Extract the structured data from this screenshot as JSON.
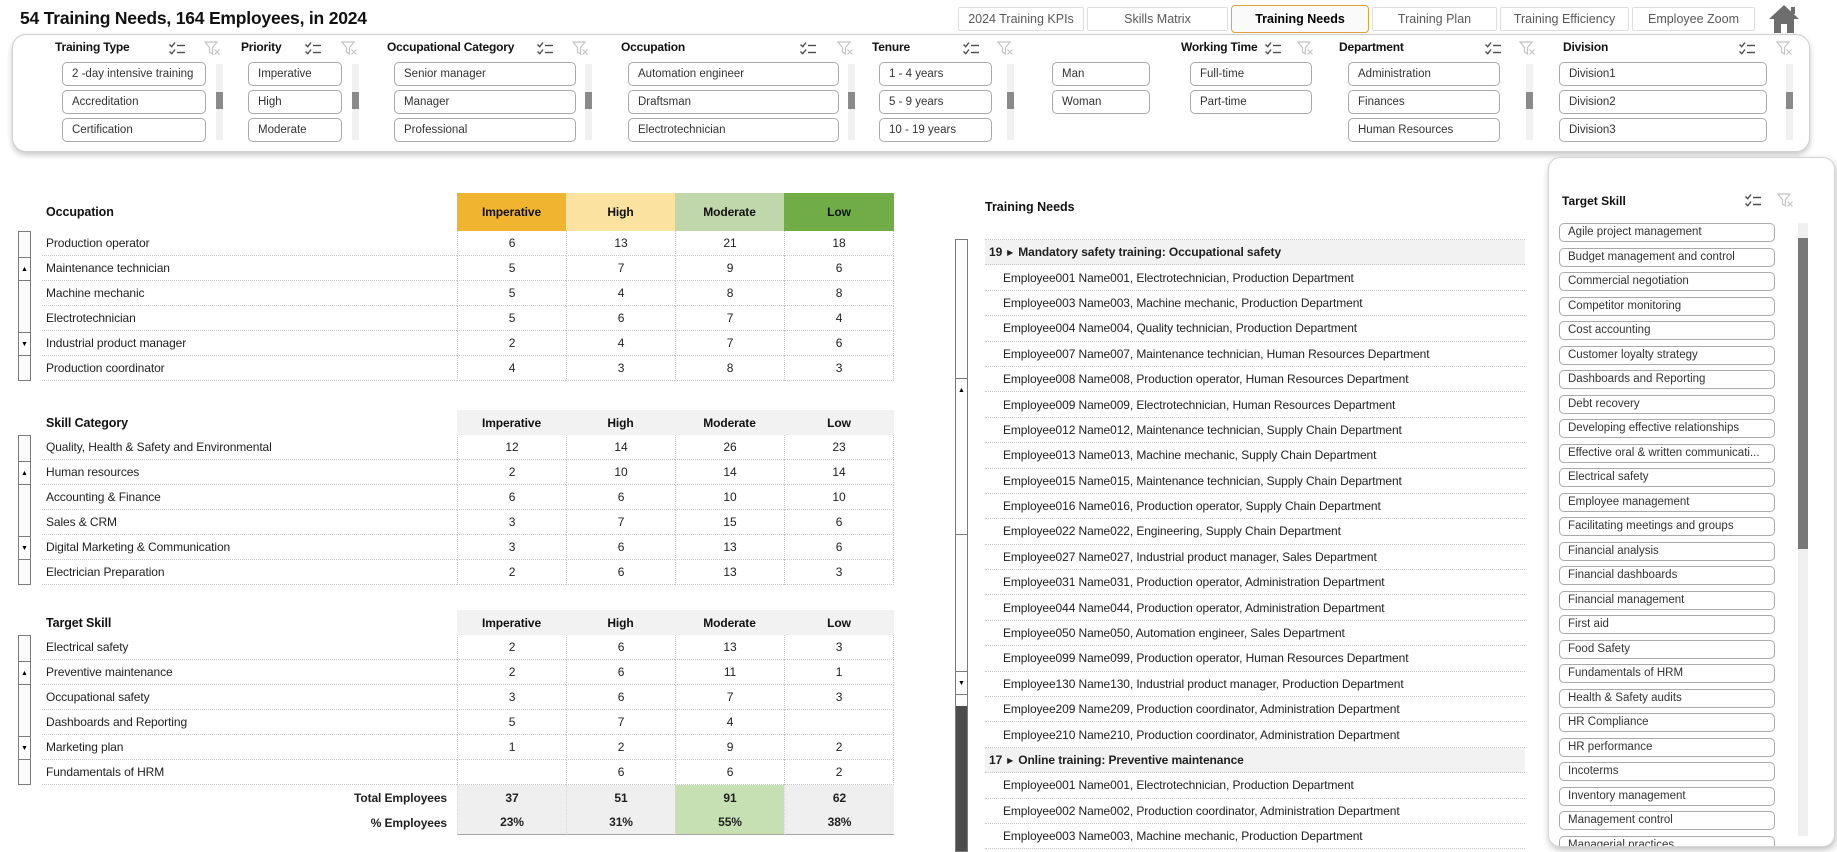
{
  "title": "54 Training Needs, 164 Employees, in 2024",
  "tabs": [
    {
      "label": "2024 Training KPIs",
      "active": false
    },
    {
      "label": "Skills Matrix",
      "active": false
    },
    {
      "label": "Training Needs",
      "active": true
    },
    {
      "label": "Training Plan",
      "active": false
    },
    {
      "label": "Training Efficiency",
      "active": false
    },
    {
      "label": "Employee Zoom",
      "active": false
    }
  ],
  "filters": [
    {
      "title": "Training Type",
      "items": [
        "2 -day intensive training",
        "Accreditation",
        "Certification"
      ],
      "scrollbar": true
    },
    {
      "title": "Priority",
      "items": [
        "Imperative",
        "High",
        "Moderate"
      ],
      "scrollbar": true
    },
    {
      "title": "Occupational Category",
      "items": [
        "Senior manager",
        "Manager",
        "Professional"
      ],
      "scrollbar": true
    },
    {
      "title": "Occupation",
      "items": [
        "Automation engineer",
        "Draftsman",
        "Electrotechnician"
      ],
      "scrollbar": true
    },
    {
      "title": "Tenure",
      "items": [
        "1 - 4 years",
        "5 - 9 years",
        "10 - 19 years"
      ],
      "scrollbar": true
    },
    {
      "title": "",
      "items": [
        "Man",
        "Woman"
      ],
      "scrollbar": false
    },
    {
      "title": "Working Time",
      "items": [
        "Full-time",
        "Part-time"
      ],
      "scrollbar": false
    },
    {
      "title": "Department",
      "items": [
        "Administration",
        "Finances",
        "Human Resources"
      ],
      "scrollbar": true
    },
    {
      "title": "Division",
      "items": [
        "Division1",
        "Division2",
        "Division3"
      ],
      "scrollbar": true
    }
  ],
  "columns": [
    "Imperative",
    "High",
    "Moderate",
    "Low"
  ],
  "tables": [
    {
      "title": "Occupation",
      "colored_header": true,
      "rows": [
        {
          "label": "Production operator",
          "values": [
            "6",
            "13",
            "21",
            "18"
          ]
        },
        {
          "label": "Maintenance technician",
          "values": [
            "5",
            "7",
            "9",
            "6"
          ]
        },
        {
          "label": "Machine mechanic",
          "values": [
            "5",
            "4",
            "8",
            "8"
          ]
        },
        {
          "label": "Electrotechnician",
          "values": [
            "5",
            "6",
            "7",
            "4"
          ]
        },
        {
          "label": "Industrial product manager",
          "values": [
            "2",
            "4",
            "7",
            "6"
          ]
        },
        {
          "label": "Production coordinator",
          "values": [
            "4",
            "3",
            "8",
            "3"
          ]
        }
      ]
    },
    {
      "title": "Skill Category",
      "colored_header": false,
      "rows": [
        {
          "label": "Quality, Health & Safety and Environmental",
          "values": [
            "12",
            "14",
            "26",
            "23"
          ]
        },
        {
          "label": "Human resources",
          "values": [
            "2",
            "10",
            "14",
            "14"
          ]
        },
        {
          "label": "Accounting & Finance",
          "values": [
            "6",
            "6",
            "10",
            "10"
          ]
        },
        {
          "label": "Sales & CRM",
          "values": [
            "3",
            "7",
            "15",
            "6"
          ]
        },
        {
          "label": "Digital Marketing & Communication",
          "values": [
            "3",
            "6",
            "13",
            "6"
          ]
        },
        {
          "label": "Electrician Preparation",
          "values": [
            "2",
            "6",
            "13",
            "3"
          ]
        }
      ]
    },
    {
      "title": "Target Skill",
      "colored_header": false,
      "rows": [
        {
          "label": "Electrical safety",
          "values": [
            "2",
            "6",
            "13",
            "3"
          ]
        },
        {
          "label": "Preventive maintenance",
          "values": [
            "2",
            "6",
            "11",
            "1"
          ]
        },
        {
          "label": "Occupational safety",
          "values": [
            "3",
            "6",
            "7",
            "3"
          ]
        },
        {
          "label": "Dashboards and Reporting",
          "values": [
            "5",
            "7",
            "4",
            ""
          ]
        },
        {
          "label": "Marketing plan",
          "values": [
            "1",
            "2",
            "9",
            "2"
          ]
        },
        {
          "label": "Fundamentals of HRM",
          "values": [
            "",
            "6",
            "6",
            "2"
          ]
        }
      ],
      "totals": {
        "label": "Total Employees",
        "values": [
          "37",
          "51",
          "91",
          "62"
        ],
        "highlight_col": 2
      },
      "percents": {
        "label": "% Employees",
        "values": [
          "23%",
          "31%",
          "55%",
          "38%"
        ],
        "highlight_col": 2
      }
    }
  ],
  "training_needs": {
    "title": "Training Needs",
    "groups": [
      {
        "count": "19",
        "title": "Mandatory safety training: Occupational safety",
        "employees": [
          "Employee001 Name001, Electrotechnician, Production Department",
          "Employee003 Name003, Machine mechanic, Production Department",
          "Employee004 Name004, Quality technician, Production Department",
          "Employee007 Name007, Maintenance technician, Human Resources Department",
          "Employee008 Name008, Production operator, Human Resources Department",
          "Employee009 Name009, Electrotechnician, Human Resources Department",
          "Employee012 Name012, Maintenance technician, Supply Chain Department",
          "Employee013 Name013, Machine mechanic, Supply Chain Department",
          "Employee015 Name015, Maintenance technician, Supply Chain Department",
          "Employee016 Name016, Production operator, Supply Chain Department",
          "Employee022 Name022, Engineering, Supply Chain Department",
          "Employee027 Name027, Industrial product manager, Sales Department",
          "Employee031 Name031, Production operator, Administration Department",
          "Employee044 Name044, Production operator, Administration Department",
          "Employee050 Name050, Automation engineer, Sales Department",
          "Employee099 Name099, Production operator, Human Resources Department",
          "Employee130 Name130, Industrial product manager, Production Department",
          "Employee209 Name209, Production coordinator, Administration Department",
          "Employee210 Name210, Production coordinator, Administration Department"
        ]
      },
      {
        "count": "17",
        "title": "Online training: Preventive maintenance",
        "employees": [
          "Employee001 Name001, Electrotechnician, Production Department",
          "Employee002 Name002, Production coordinator, Administration Department",
          "Employee003 Name003, Machine mechanic, Production Department"
        ]
      }
    ]
  },
  "target_skill_slicer": {
    "title": "Target Skill",
    "items": [
      "Agile project management",
      "Budget management and control",
      "Commercial negotiation",
      "Competitor monitoring",
      "Cost accounting",
      "Customer loyalty strategy",
      "Dashboards and Reporting",
      "Debt recovery",
      "Developing effective relationships",
      "Effective oral & written communicati...",
      "Electrical safety",
      "Employee management",
      "Facilitating meetings and groups",
      "Financial analysis",
      "Financial dashboards",
      "Financial management",
      "First aid",
      "Food Safety",
      "Fundamentals of HRM",
      "Health & Safety audits",
      "HR Compliance",
      "HR performance",
      "Incoterms",
      "Inventory management",
      "Management control",
      "Managerial practices"
    ]
  },
  "colors": {
    "imperative": "#F1B42E",
    "high": "#FBE2A0",
    "moderate": "#BFD7AA",
    "low": "#71AD47",
    "highlight": "#C6E0B4",
    "accent_gold": "#E2A43B"
  }
}
